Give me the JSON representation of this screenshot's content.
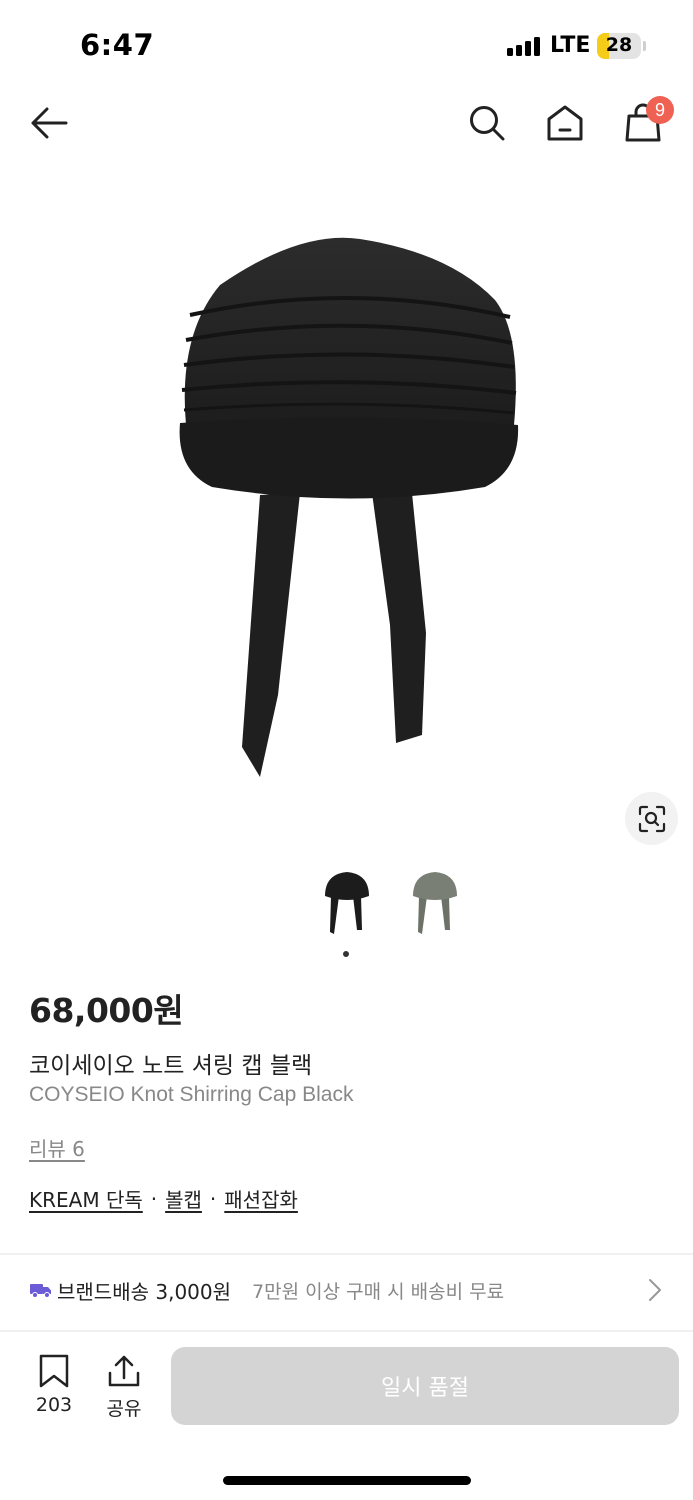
{
  "status_bar": {
    "time": "6:47",
    "network": "LTE",
    "battery": "28"
  },
  "nav": {
    "back_icon": "arrow-left-icon",
    "search_icon": "search-icon",
    "home_icon": "home-icon",
    "cart_icon": "shopping-bag-icon",
    "cart_count": "9"
  },
  "gallery": {
    "main_image": "black-shirring-cap-photo",
    "lens_icon": "image-search-icon",
    "thumbnails": [
      "black-cap-thumbnail",
      "khaki-cap-thumbnail"
    ],
    "active_index": 0
  },
  "product": {
    "price": "68,000원",
    "name_ko": "코이세이오 노트 셔링 캡 블랙",
    "name_en": "COYSEIO Knot Shirring Cap Black",
    "reviews": "리뷰 6",
    "tags": [
      "KREAM 단독",
      "볼캡",
      "패션잡화"
    ],
    "tag_separator": "·"
  },
  "shipping": {
    "icon": "truck-icon",
    "label": "브랜드배송 3,000원",
    "note": "7만원 이상 구매 시 배송비 무료"
  },
  "bottom_bar": {
    "bookmark_count": "203",
    "share_label": "공유",
    "buy_button": "일시 품절"
  },
  "colors": {
    "badge": "#ef6253",
    "shipping_icon": "#6b5bd6",
    "disabled_button": "#d4d4d4"
  }
}
